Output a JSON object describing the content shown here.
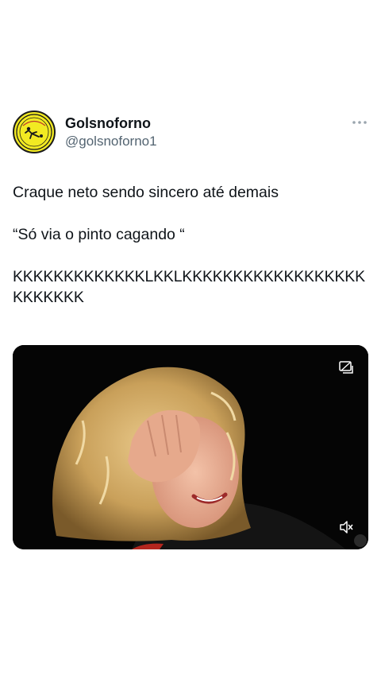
{
  "tweet": {
    "author": {
      "display_name": "Golsnoforno",
      "handle": "@golsnoforno1",
      "avatar_text": "GOLS NO FORNO"
    },
    "more_icon": "ellipsis-icon",
    "text": {
      "line1": "Craque neto sendo sincero até demais",
      "line2": "“Só via o pinto cagando “",
      "line3": "KKKKKKKKKKKKKLKKLKKKKKKKKKKKKKKKKKKKKKKKKK"
    },
    "media": {
      "type": "video",
      "pip_icon": "picture-in-picture-icon",
      "mute_icon": "speaker-muted-icon"
    }
  },
  "colors": {
    "background": "#ffffff",
    "text": "#0f1419",
    "secondary": "#536471",
    "avatar_yellow": "#f2ea22",
    "media_bg": "#000000"
  }
}
